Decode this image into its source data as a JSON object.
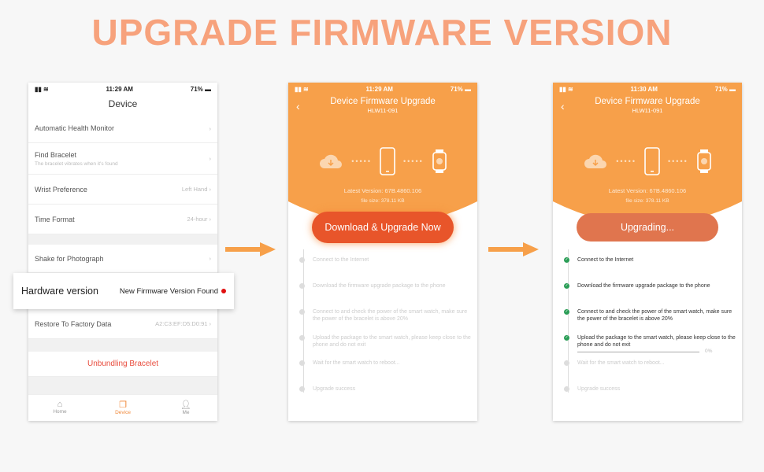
{
  "headline": "UPGRADE FIRMWARE VERSION",
  "colors": {
    "title": "#f7a27c",
    "accent": "#f7a04a",
    "button": "#e8552a",
    "done": "#2a9d56",
    "alert": "#e01010"
  },
  "screen1": {
    "status": {
      "time": "11:29 AM",
      "battery": "71%"
    },
    "title": "Device",
    "rows": [
      {
        "label": "Automatic Health Monitor",
        "value": ""
      },
      {
        "label": "Find Bracelet",
        "sub": "The bracelet vibrates when it's found"
      },
      {
        "label": "Wrist Preference",
        "value": "Left Hand"
      },
      {
        "label": "Time Format",
        "value": "24-hour"
      },
      {
        "label": "Shake for Photograph",
        "value": ""
      },
      {
        "label": "Restore To Factory Data",
        "value": "A2:C3:EF:D5:D0:91"
      }
    ],
    "hardware": {
      "label": "Hardware version",
      "notice": "New Firmware Version Found"
    },
    "unbind": "Unbundling Bracelet",
    "tabs": [
      {
        "label": "Home",
        "icon": "home-icon"
      },
      {
        "label": "Device",
        "icon": "device-icon"
      },
      {
        "label": "Me",
        "icon": "person-icon"
      }
    ]
  },
  "screen2": {
    "status": {
      "time": "11:29 AM",
      "battery": "71%"
    },
    "title": "Device Firmware Upgrade",
    "model": "HLW11-091",
    "version": "Latest Version: 67B.4860.106",
    "filesize": "file size: 378.11 KB",
    "button": "Download & Upgrade Now"
  },
  "screen3": {
    "status": {
      "time": "11:30 AM",
      "battery": "71%"
    },
    "title": "Device Firmware Upgrade",
    "model": "HLW11-091",
    "version": "Latest Version: 67B.4860.106",
    "filesize": "file size: 378.11 KB",
    "button": "Upgrading...",
    "progress": "0%"
  },
  "steps": [
    "Connect to the Internet",
    "Download the firmware upgrade package to the phone",
    "Connect to and check the power of the smart watch, make sure the power of the bracelet is above 20%",
    "Upload the package to the smart watch, please keep close to the phone and do not exit",
    "Wait for the smart watch to reboot...",
    "Upgrade success"
  ]
}
